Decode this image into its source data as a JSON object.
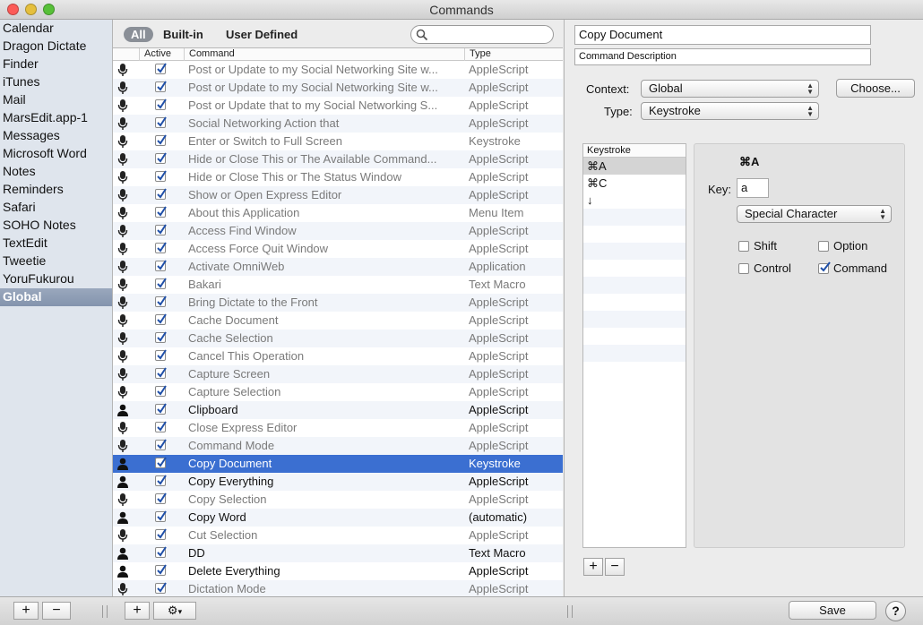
{
  "window": {
    "title": "Commands"
  },
  "sidebar": {
    "items": [
      {
        "label": "Calendar"
      },
      {
        "label": "Dragon Dictate"
      },
      {
        "label": "Finder"
      },
      {
        "label": "iTunes"
      },
      {
        "label": "Mail"
      },
      {
        "label": "MarsEdit.app-1"
      },
      {
        "label": "Messages"
      },
      {
        "label": "Microsoft Word"
      },
      {
        "label": "Notes"
      },
      {
        "label": "Reminders"
      },
      {
        "label": "Safari"
      },
      {
        "label": "SOHO Notes"
      },
      {
        "label": "TextEdit"
      },
      {
        "label": "Tweetie"
      },
      {
        "label": "YoruFukurou"
      },
      {
        "label": "Global",
        "selected": true
      }
    ]
  },
  "filters": {
    "all": "All",
    "builtin": "Built-in",
    "user": "User Defined"
  },
  "search": {
    "placeholder": ""
  },
  "table": {
    "columns": {
      "active": "Active",
      "command": "Command",
      "type": "Type"
    },
    "rows": [
      {
        "icon": "microphone-icon",
        "active": true,
        "command": "Post or Update to my Social Networking Site w...",
        "type": "AppleScript",
        "user": false
      },
      {
        "icon": "microphone-icon",
        "active": true,
        "command": "Post or Update to my Social Networking Site w...",
        "type": "AppleScript",
        "user": false
      },
      {
        "icon": "microphone-icon",
        "active": true,
        "command": "Post or Update that to my Social Networking S...",
        "type": "AppleScript",
        "user": false
      },
      {
        "icon": "microphone-icon",
        "active": true,
        "command": "Social Networking Action that",
        "type": "AppleScript",
        "user": false
      },
      {
        "icon": "microphone-icon",
        "active": true,
        "command": "Enter or Switch to Full Screen",
        "type": "Keystroke",
        "user": false
      },
      {
        "icon": "microphone-icon",
        "active": true,
        "command": "Hide or Close This or The Available Command...",
        "type": "AppleScript",
        "user": false
      },
      {
        "icon": "microphone-icon",
        "active": true,
        "command": "Hide or Close This or The Status Window",
        "type": "AppleScript",
        "user": false
      },
      {
        "icon": "microphone-icon",
        "active": true,
        "command": "Show or Open Express Editor",
        "type": "AppleScript",
        "user": false
      },
      {
        "icon": "microphone-icon",
        "active": true,
        "command": "About this Application",
        "type": "Menu Item",
        "user": false
      },
      {
        "icon": "microphone-icon",
        "active": true,
        "command": "Access Find Window",
        "type": "AppleScript",
        "user": false
      },
      {
        "icon": "microphone-icon",
        "active": true,
        "command": "Access Force Quit Window",
        "type": "AppleScript",
        "user": false
      },
      {
        "icon": "microphone-icon",
        "active": true,
        "command": "Activate OmniWeb",
        "type": "Application",
        "user": false
      },
      {
        "icon": "microphone-icon",
        "active": true,
        "command": "Bakari",
        "type": "Text Macro",
        "user": false
      },
      {
        "icon": "microphone-icon",
        "active": true,
        "command": "Bring Dictate to the Front",
        "type": "AppleScript",
        "user": false
      },
      {
        "icon": "microphone-icon",
        "active": true,
        "command": "Cache Document",
        "type": "AppleScript",
        "user": false
      },
      {
        "icon": "microphone-icon",
        "active": true,
        "command": "Cache Selection",
        "type": "AppleScript",
        "user": false
      },
      {
        "icon": "microphone-icon",
        "active": true,
        "command": "Cancel This Operation",
        "type": "AppleScript",
        "user": false
      },
      {
        "icon": "microphone-icon",
        "active": true,
        "command": "Capture Screen",
        "type": "AppleScript",
        "user": false
      },
      {
        "icon": "microphone-icon",
        "active": true,
        "command": "Capture Selection",
        "type": "AppleScript",
        "user": false
      },
      {
        "icon": "person-icon",
        "active": true,
        "command": "Clipboard",
        "type": "AppleScript",
        "user": true
      },
      {
        "icon": "microphone-icon",
        "active": true,
        "command": "Close Express Editor",
        "type": "AppleScript",
        "user": false
      },
      {
        "icon": "microphone-icon",
        "active": true,
        "command": "Command Mode",
        "type": "AppleScript",
        "user": false
      },
      {
        "icon": "person-icon",
        "active": true,
        "command": "Copy Document",
        "type": "Keystroke",
        "user": true,
        "selected": true
      },
      {
        "icon": "person-icon",
        "active": true,
        "command": "Copy Everything",
        "type": "AppleScript",
        "user": true
      },
      {
        "icon": "microphone-icon",
        "active": true,
        "command": "Copy Selection",
        "type": "AppleScript",
        "user": false
      },
      {
        "icon": "person-icon",
        "active": true,
        "command": "Copy Word",
        "type": "(automatic)",
        "user": true
      },
      {
        "icon": "microphone-icon",
        "active": true,
        "command": "Cut Selection",
        "type": "AppleScript",
        "user": false
      },
      {
        "icon": "person-icon",
        "active": true,
        "command": "DD",
        "type": "Text Macro",
        "user": true
      },
      {
        "icon": "person-icon",
        "active": true,
        "command": "Delete Everything",
        "type": "AppleScript",
        "user": true
      },
      {
        "icon": "microphone-icon",
        "active": true,
        "command": "Dictation Mode",
        "type": "AppleScript",
        "user": false
      }
    ]
  },
  "detail": {
    "name": "Copy Document",
    "description": "Command Description",
    "context_label": "Context:",
    "context_value": "Global",
    "choose_label": "Choose...",
    "type_label": "Type:",
    "type_value": "Keystroke",
    "keystroke_header": "Keystroke",
    "keystrokes": [
      "⌘A",
      "⌘C",
      "↓"
    ],
    "shortcut_display": "⌘A",
    "key_label": "Key:",
    "key_value": "a",
    "special_char": "Special Character",
    "modifiers": {
      "shift": {
        "label": "Shift",
        "checked": false
      },
      "option": {
        "label": "Option",
        "checked": false
      },
      "control": {
        "label": "Control",
        "checked": false
      },
      "command": {
        "label": "Command",
        "checked": true
      }
    }
  },
  "bottom": {
    "add": "+",
    "remove": "−",
    "save": "Save",
    "help": "?"
  },
  "colors": {
    "selection": "#3b6fd1",
    "sidebar_bg": "#dfe5ed",
    "sidebar_selected": "#8394ad"
  }
}
